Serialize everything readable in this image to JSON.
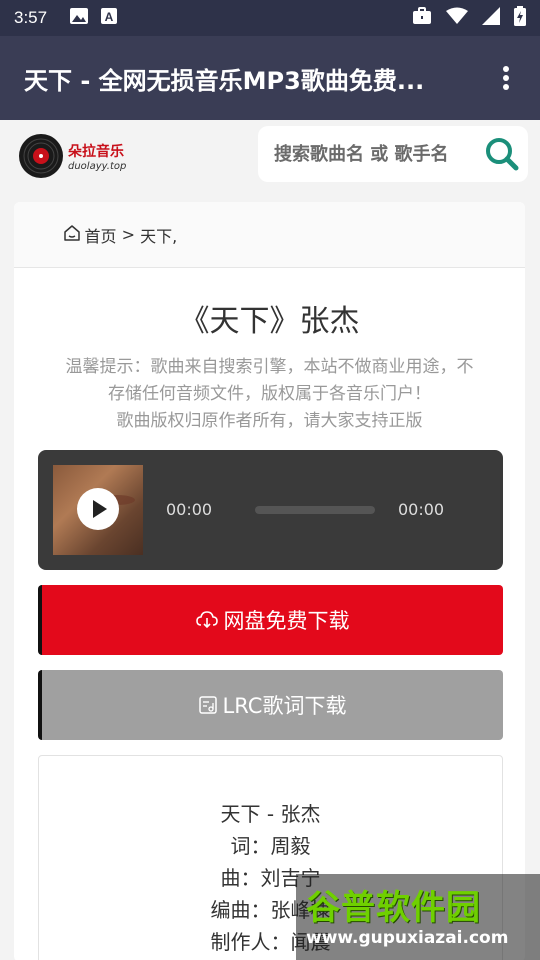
{
  "status_bar": {
    "time": "3:57",
    "left_icons": [
      "image-icon",
      "text-a-icon"
    ],
    "right_icons": [
      "briefcase-icon",
      "wifi-icon",
      "signal-icon",
      "battery-icon"
    ]
  },
  "app_bar": {
    "title": "天下 - 全网无损音乐MP3歌曲免费...",
    "menu_icon": "more-vert-icon"
  },
  "site": {
    "logo_cn": "朵拉音乐",
    "logo_en": "duolayy.top",
    "search_placeholder": "搜索歌曲名 或 歌手名",
    "search_icon": "search-icon"
  },
  "breadcrumb": {
    "home": "首页",
    "separator": " > ",
    "current": "天下,"
  },
  "song": {
    "title": "《天下》张杰",
    "notice_line1": "温馨提示：歌曲来自搜索引擎，本站不做商业用途，不",
    "notice_line2": "存储任何音频文件，版权属于各音乐门户！",
    "notice_line3": "歌曲版权归原作者所有，请大家支持正版"
  },
  "player": {
    "current_time": "00:00",
    "total_time": "00:00",
    "progress": 0
  },
  "buttons": {
    "download_label": "网盘免费下载",
    "lrc_label": "LRC歌词下载"
  },
  "lyrics": [
    "天下 - 张杰",
    "词：周毅",
    "曲：刘吉宁",
    "编曲：张峰棣",
    "制作人：闻震"
  ],
  "watermark": {
    "text": "谷普软件园",
    "url": "www.gupuxiazai.com"
  },
  "colors": {
    "status_bar": "#2e3249",
    "app_bar": "#3a3d55",
    "download_button": "#e3091b",
    "lrc_button": "#a0a0a0",
    "search_icon": "#1b8f7a"
  }
}
